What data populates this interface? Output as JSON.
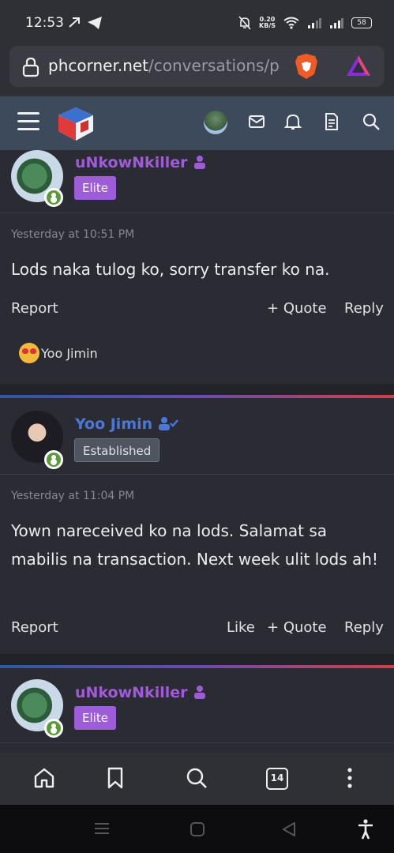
{
  "status_bar": {
    "time": "12:53",
    "net_speed_value": "0.20",
    "net_speed_unit": "KB/S",
    "battery": "58",
    "icons": [
      "missed-call-icon",
      "telegram-icon",
      "mute-icon",
      "wifi-icon",
      "signal-icon",
      "signal-icon"
    ]
  },
  "browser": {
    "url_host": "phcorner.net",
    "url_path": "/conversations/p",
    "icons": [
      "lock-icon",
      "brave-shield-icon",
      "brave-rewards-icon"
    ]
  },
  "site_header": {
    "icons": [
      "menu-icon",
      "site-logo",
      "user-avatar",
      "mail-icon",
      "bell-icon",
      "document-icon",
      "search-icon"
    ]
  },
  "posts": [
    {
      "username": "uNkowNkiller",
      "badge": "Elite",
      "time": "Yesterday at 10:51 PM",
      "body": "Lods naka tulog ko, sorry transfer ko na.",
      "actions": {
        "report": "Report",
        "quote": "Quote",
        "reply": "Reply"
      },
      "reaction_user": "Yoo Jimin"
    },
    {
      "username": "Yoo Jimin",
      "badge": "Established",
      "time": "Yesterday at 11:04 PM",
      "body": "Yown nareceived ko na lods. Salamat sa mabilis na transaction. Next week ulit lods ah!",
      "actions": {
        "report": "Report",
        "like": "Like",
        "quote": "Quote",
        "reply": "Reply"
      }
    },
    {
      "username": "uNkowNkiller",
      "badge": "Elite"
    }
  ],
  "bottom_nav": {
    "tab_count": "14",
    "icons": [
      "home-icon",
      "bookmark-icon",
      "search-icon",
      "tabs-icon",
      "more-icon"
    ]
  },
  "colors": {
    "elite": "#9d5cd8",
    "established_name": "#4a78d8",
    "header_bar": "#3c4a5c",
    "background": "#2b2c33"
  }
}
